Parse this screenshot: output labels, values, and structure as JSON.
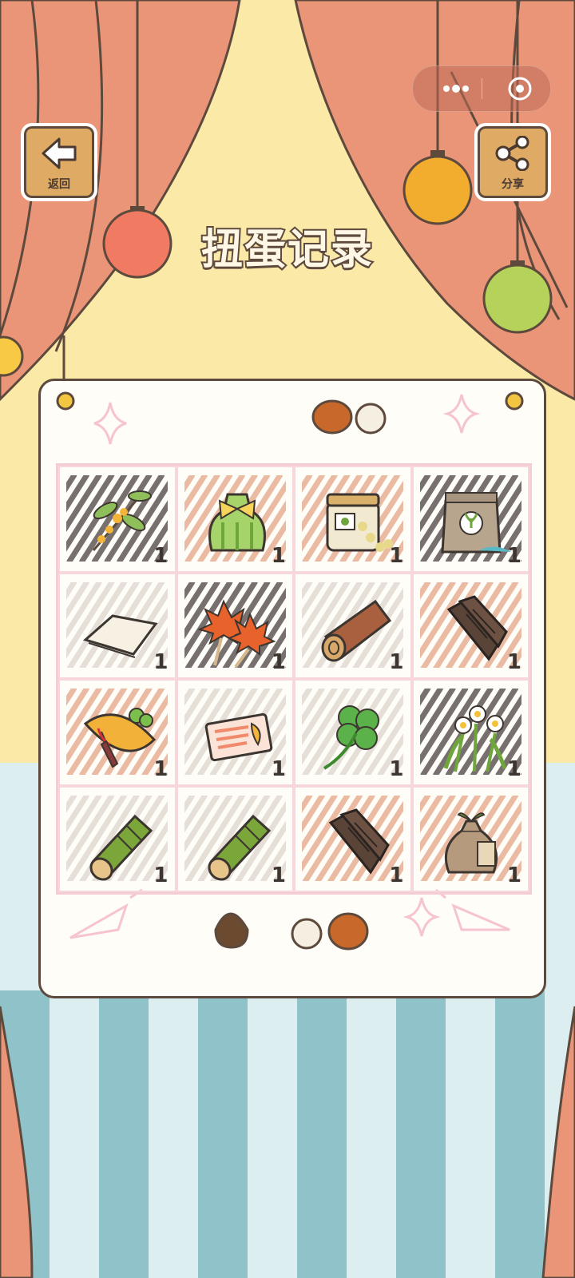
{
  "title": "扭蛋记录",
  "nav": {
    "back_label": "返回",
    "share_label": "分享"
  },
  "miniprogram": {
    "more_icon": "more-dots-icon",
    "close_icon": "close-target-icon"
  },
  "colors": {
    "curtain": "#ea9478",
    "wall": "#fbe9a8",
    "floor_stripe": "#8fc3c9",
    "outline": "#5d4a3d",
    "grid_pink": "#f3cdd3"
  },
  "items": [
    {
      "icon": "osmanthus-branch-icon",
      "count": "1"
    },
    {
      "icon": "green-gift-bag-icon",
      "count": "1"
    },
    {
      "icon": "soybean-jar-icon",
      "count": "1"
    },
    {
      "icon": "seed-bag-icon",
      "count": "1"
    },
    {
      "icon": "tofu-skin-icon",
      "count": "1"
    },
    {
      "icon": "maple-leaves-icon",
      "count": "1"
    },
    {
      "icon": "wooden-log-icon",
      "count": "1"
    },
    {
      "icon": "dark-bark-icon",
      "count": "1"
    },
    {
      "icon": "omelette-icon",
      "count": "1"
    },
    {
      "icon": "salmon-slice-icon",
      "count": "1"
    },
    {
      "icon": "four-leaf-clover-icon",
      "count": "1"
    },
    {
      "icon": "narcissus-flower-icon",
      "count": "1"
    },
    {
      "icon": "bamboo-tube-icon",
      "count": "1"
    },
    {
      "icon": "bamboo-tube-icon",
      "count": "1"
    },
    {
      "icon": "dark-bark-icon",
      "count": "1"
    },
    {
      "icon": "sprout-sack-icon",
      "count": "1"
    }
  ]
}
